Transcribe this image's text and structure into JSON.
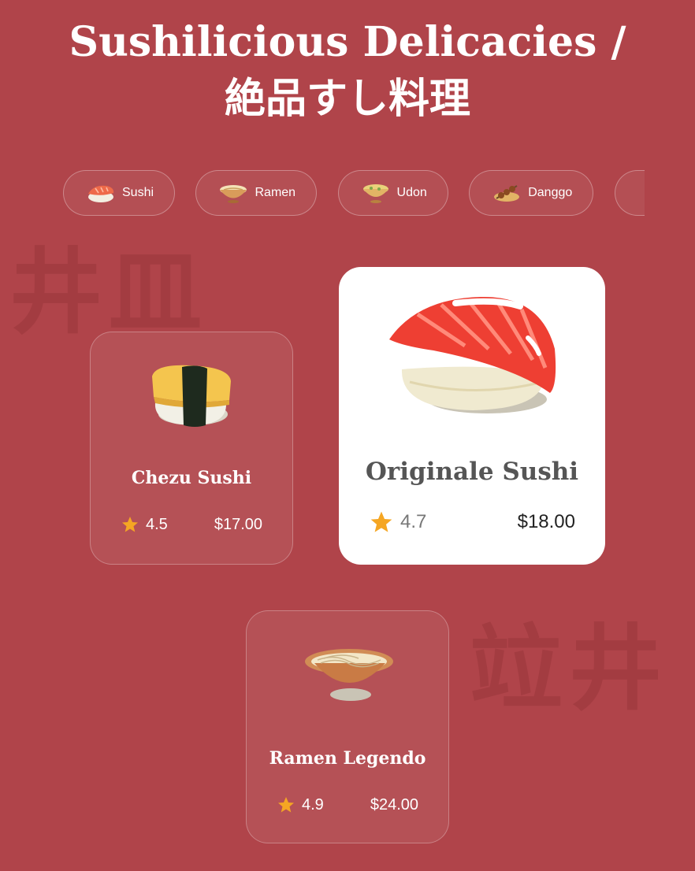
{
  "header": {
    "title": "Sushilicious Delicacies / 絶品すし料理"
  },
  "background_glyphs": [
    "井皿",
    "竝井"
  ],
  "categories": [
    {
      "label": "Sushi",
      "icon": "sushi-icon"
    },
    {
      "label": "Ramen",
      "icon": "ramen-bowl-icon"
    },
    {
      "label": "Udon",
      "icon": "udon-bowl-icon"
    },
    {
      "label": "Danggo",
      "icon": "dango-icon"
    },
    {
      "label": "",
      "icon": "partial-chip"
    }
  ],
  "items": [
    {
      "name": "Chezu Sushi",
      "rating": "4.5",
      "price": "$17.00",
      "icon": "tamago-sushi-icon"
    },
    {
      "name": "Originale Sushi",
      "rating": "4.7",
      "price": "$18.00",
      "icon": "salmon-nigiri-icon",
      "featured": true
    },
    {
      "name": "Ramen Legendo",
      "rating": "4.9",
      "price": "$24.00",
      "icon": "ramen-noodle-icon"
    }
  ],
  "colors": {
    "background": "#b0444a",
    "star": "#f5a623",
    "featured_card": "#ffffff"
  }
}
